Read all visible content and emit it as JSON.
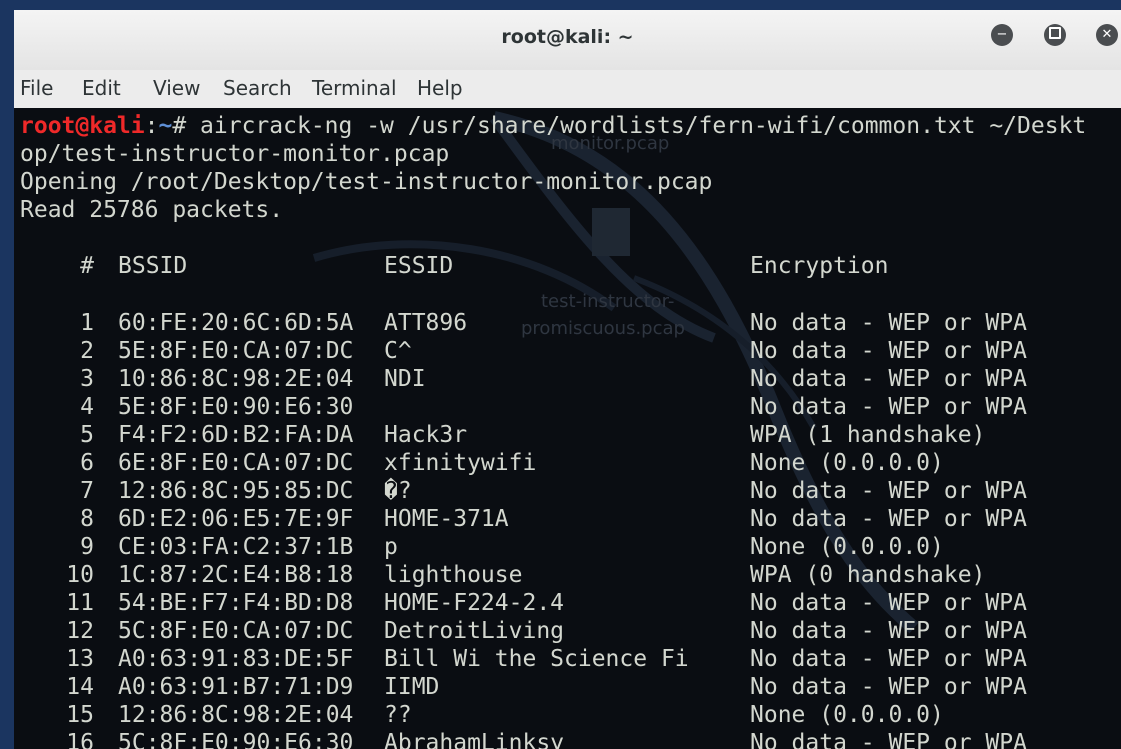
{
  "window": {
    "title": "root@kali: ~"
  },
  "menu": [
    "File",
    "Edit",
    "View",
    "Search",
    "Terminal",
    "Help"
  ],
  "prompt": {
    "user": "root@kali",
    "path": "~",
    "symbol": "# "
  },
  "command_line_1": "aircrack-ng -w /usr/share/wordlists/fern-wifi/common.txt ~/Deskt",
  "command_line_2": "op/test-instructor-monitor.pcap",
  "output": [
    "Opening /root/Desktop/test-instructor-monitor.pcap",
    "Read 25786 packets."
  ],
  "headers": {
    "num": "#",
    "bssid": "BSSID",
    "essid": "ESSID",
    "encryption": "Encryption"
  },
  "networks": [
    {
      "num": "1",
      "bssid": "60:FE:20:6C:6D:5A",
      "essid": "ATT896",
      "encryption": "No data - WEP or WPA"
    },
    {
      "num": "2",
      "bssid": "5E:8F:E0:CA:07:DC",
      "essid": "C^",
      "encryption": "No data - WEP or WPA"
    },
    {
      "num": "3",
      "bssid": "10:86:8C:98:2E:04",
      "essid": "NDI",
      "encryption": "No data - WEP or WPA"
    },
    {
      "num": "4",
      "bssid": "5E:8F:E0:90:E6:30",
      "essid": "",
      "encryption": "No data - WEP or WPA"
    },
    {
      "num": "5",
      "bssid": "F4:F2:6D:B2:FA:DA",
      "essid": "Hack3r",
      "encryption": "WPA (1 handshake)"
    },
    {
      "num": "6",
      "bssid": "6E:8F:E0:CA:07:DC",
      "essid": "xfinitywifi",
      "encryption": "None (0.0.0.0)"
    },
    {
      "num": "7",
      "bssid": "12:86:8C:95:85:DC",
      "essid": "�?",
      "encryption": "No data - WEP or WPA"
    },
    {
      "num": "8",
      "bssid": "6D:E2:06:E5:7E:9F",
      "essid": "HOME-371A",
      "encryption": "No data - WEP or WPA"
    },
    {
      "num": "9",
      "bssid": "CE:03:FA:C2:37:1B",
      "essid": "p",
      "encryption": "None (0.0.0.0)"
    },
    {
      "num": "10",
      "bssid": "1C:87:2C:E4:B8:18",
      "essid": "lighthouse",
      "encryption": "WPA (0 handshake)"
    },
    {
      "num": "11",
      "bssid": "54:BE:F7:F4:BD:D8",
      "essid": "HOME-F224-2.4",
      "encryption": "No data - WEP or WPA"
    },
    {
      "num": "12",
      "bssid": "5C:8F:E0:CA:07:DC",
      "essid": "DetroitLiving",
      "encryption": "No data - WEP or WPA"
    },
    {
      "num": "13",
      "bssid": "A0:63:91:83:DE:5F",
      "essid": "Bill Wi the Science Fi",
      "encryption": "No data - WEP or WPA"
    },
    {
      "num": "14",
      "bssid": "A0:63:91:B7:71:D9",
      "essid": "IIMD",
      "encryption": "No data - WEP or WPA"
    },
    {
      "num": "15",
      "bssid": "12:86:8C:98:2E:04",
      "essid": "??",
      "encryption": "None (0.0.0.0)"
    },
    {
      "num": "16",
      "bssid": "5C:8F:E0:90:E6:30",
      "essid": "AbrahamLinksy",
      "encryption": "No data - WEP or WPA"
    }
  ],
  "desktop_labels": [
    "monitor.pcap",
    "test-instructor-",
    "promiscuous.pcap"
  ],
  "icons": {
    "minimize": "minimize-icon",
    "maximize": "maximize-icon",
    "close": "close-icon"
  },
  "colors": {
    "terminal_bg": "#0a0d12",
    "text": "#d3d7cf",
    "prompt_user": "#ef2929",
    "prompt_path": "#5e8fd6"
  }
}
